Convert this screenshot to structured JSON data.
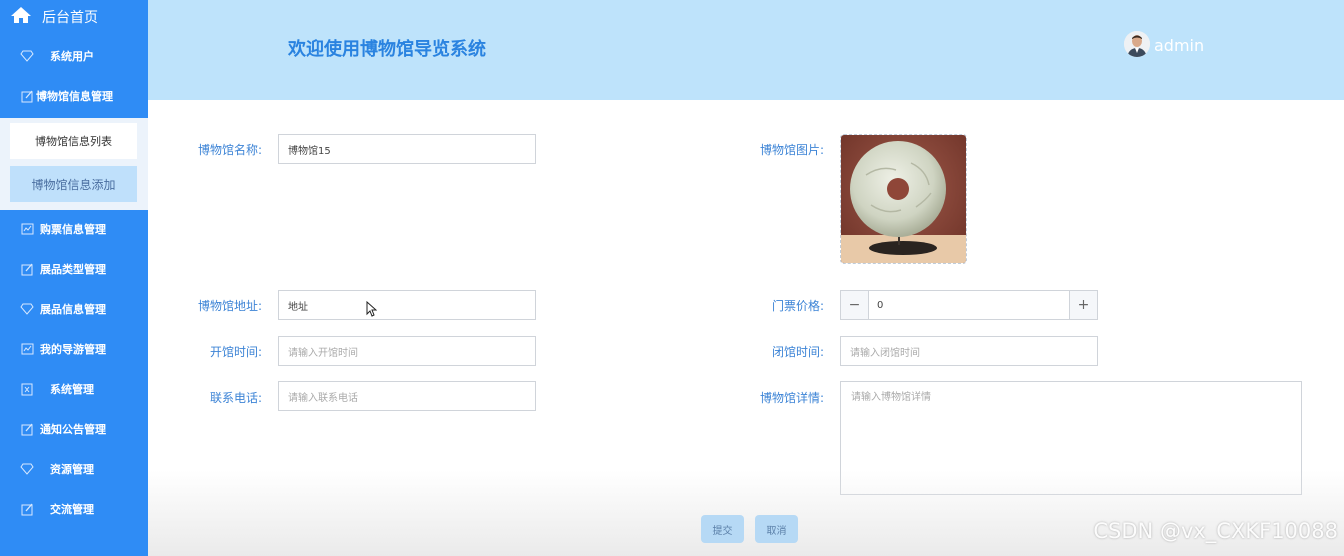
{
  "sidebar": {
    "home_label": "后台首页",
    "items": [
      {
        "label": "系统用户",
        "icon": "diamond-icon"
      },
      {
        "label": "博物馆信息管理",
        "icon": "edit-icon"
      },
      {
        "label": "购票信息管理",
        "icon": "chart-icon"
      },
      {
        "label": "展品类型管理",
        "icon": "edit-icon"
      },
      {
        "label": "展品信息管理",
        "icon": "diamond-icon"
      },
      {
        "label": "我的导游管理",
        "icon": "chart-icon"
      },
      {
        "label": "系统管理",
        "icon": "x-doc-icon"
      },
      {
        "label": "通知公告管理",
        "icon": "edit-icon"
      },
      {
        "label": "资源管理",
        "icon": "diamond-icon"
      },
      {
        "label": "交流管理",
        "icon": "edit-icon"
      }
    ],
    "submenu": [
      {
        "label": "博物馆信息列表"
      },
      {
        "label": "博物馆信息添加"
      }
    ]
  },
  "header": {
    "title": "欢迎使用博物馆导览系统",
    "user": "admin"
  },
  "form": {
    "name_label": "博物馆名称:",
    "name_value": "博物馆15",
    "image_label": "博物馆图片:",
    "address_label": "博物馆地址:",
    "address_value": "地址",
    "price_label": "门票价格:",
    "price_value": "0",
    "open_label": "开馆时间:",
    "open_placeholder": "请输入开馆时间",
    "close_label": "闭馆时间:",
    "close_placeholder": "请输入闭馆时间",
    "phone_label": "联系电话:",
    "phone_placeholder": "请输入联系电话",
    "detail_label": "博物馆详情:",
    "detail_placeholder": "请输入博物馆详情",
    "submit_label": "提交",
    "cancel_label": "取消"
  },
  "watermark": "CSDN @vx_CXKF10088",
  "colors": {
    "sidebar": "#2f8cf5",
    "header": "#bee3fb",
    "label": "#3d84d6",
    "button": "#b6d9f5"
  }
}
